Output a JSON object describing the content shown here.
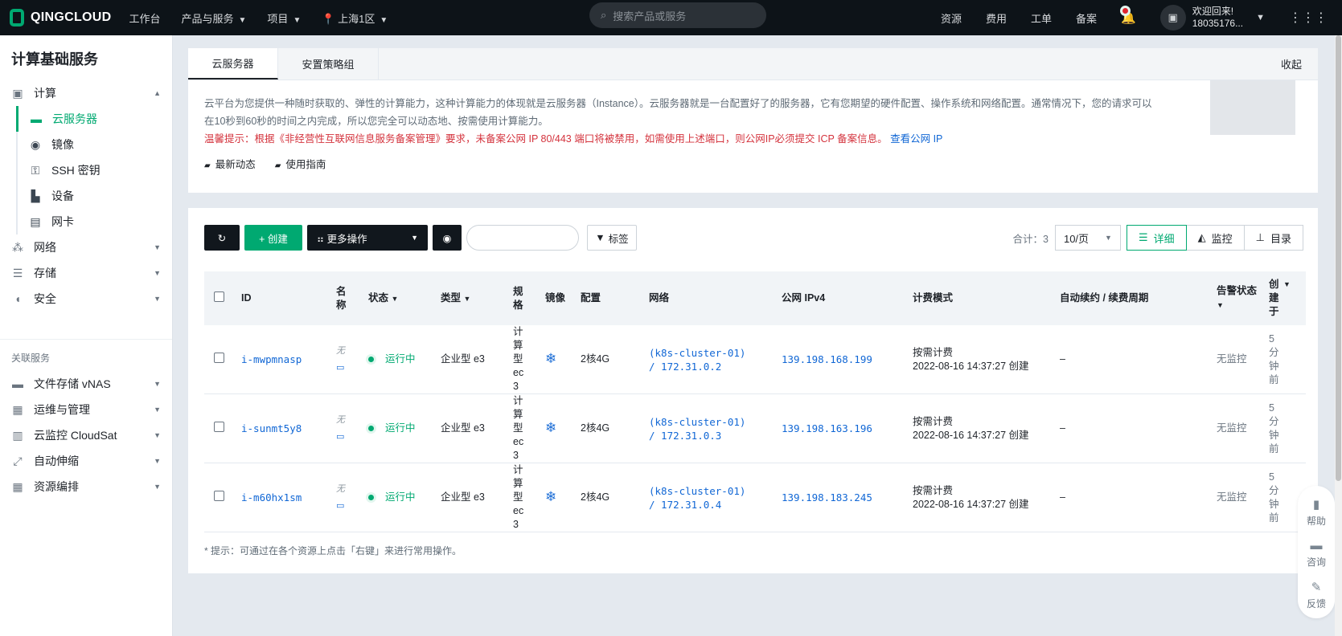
{
  "topbar": {
    "logo": "QINGCLOUD",
    "nav": [
      "工作台",
      "产品与服务",
      "项目"
    ],
    "region": "上海1区",
    "search_placeholder": "搜索产品或服务",
    "right": [
      "资源",
      "费用",
      "工单",
      "备案"
    ],
    "welcome": "欢迎回来!",
    "user": "18035176..."
  },
  "sidebar": {
    "title": "计算基础服务",
    "compute": "计算",
    "compute_items": [
      "云服务器",
      "镜像",
      "SSH 密钥",
      "设备",
      "网卡"
    ],
    "groups": [
      "网络",
      "存储",
      "安全"
    ],
    "related_label": "关联服务",
    "related": [
      "文件存储 vNAS",
      "运维与管理",
      "云监控 CloudSat",
      "自动伸缩",
      "资源编排"
    ]
  },
  "intro": {
    "tabs": [
      "云服务器",
      "安置策略组"
    ],
    "collapse": "收起",
    "desc": "云平台为您提供一种随时获取的、弹性的计算能力，这种计算能力的体现就是云服务器（Instance）。云服务器就是一台配置好了的服务器，它有您期望的硬件配置、操作系统和网络配置。通常情况下，您的请求可以在10秒到60秒的时间之内完成，所以您完全可以动态地、按需使用计算能力。",
    "warning": "温馨提示：根据《非经营性互联网信息服务备案管理》要求，未备案公网 IP 80/443 端口将被禁用，如需使用上述端口，则公网IP必须提交 ICP 备案信息。",
    "warning_link": "查看公网 IP",
    "links": [
      "最新动态",
      "使用指南"
    ]
  },
  "toolbar": {
    "create": "+ 创建",
    "more": "更多操作",
    "tag": "标签",
    "search_value": "",
    "total": "合计：3",
    "page_size": "10/页",
    "views": [
      "详细",
      "监控",
      "目录"
    ]
  },
  "table": {
    "headers": {
      "id": "ID",
      "name": "名称",
      "status": "状态",
      "type": "类型",
      "spec": "规格",
      "image": "镜像",
      "config": "配置",
      "network": "网络",
      "ip": "公网 IPv4",
      "billing": "计费模式",
      "renew": "自动续约 / 续费周期",
      "alarm": "告警状态",
      "created": "创建于"
    },
    "rows": [
      {
        "id": "i-mwpmnasp",
        "name": "无",
        "status": "运行中",
        "type": "企业型 e3",
        "spec": "计算型ec3",
        "config": "2核4G",
        "net1": "(k8s-cluster-01)",
        "net2": "/ 172.31.0.2",
        "ip": "139.198.168.199",
        "billing": "按需计费",
        "billing_time": "2022-08-16 14:37:27 创建",
        "renew": "–",
        "alarm": "无监控",
        "created": "5分钟前"
      },
      {
        "id": "i-sunmt5y8",
        "name": "无",
        "status": "运行中",
        "type": "企业型 e3",
        "spec": "计算型ec3",
        "config": "2核4G",
        "net1": "(k8s-cluster-01)",
        "net2": "/ 172.31.0.3",
        "ip": "139.198.163.196",
        "billing": "按需计费",
        "billing_time": "2022-08-16 14:37:27 创建",
        "renew": "–",
        "alarm": "无监控",
        "created": "5分钟前"
      },
      {
        "id": "i-m60hx1sm",
        "name": "无",
        "status": "运行中",
        "type": "企业型 e3",
        "spec": "计算型ec3",
        "config": "2核4G",
        "net1": "(k8s-cluster-01)",
        "net2": "/ 172.31.0.4",
        "ip": "139.198.183.245",
        "billing": "按需计费",
        "billing_time": "2022-08-16 14:37:27 创建",
        "renew": "–",
        "alarm": "无监控",
        "created": "5分钟前"
      }
    ]
  },
  "tip": "* 提示：可通过在各个资源上点击「右键」来进行常用操作。",
  "helper": [
    "帮助",
    "咨询",
    "反馈"
  ],
  "colors": {
    "accent": "#00a971",
    "link": "#1167d5",
    "warning": "#d4333d",
    "topbar": "#0d1318"
  }
}
